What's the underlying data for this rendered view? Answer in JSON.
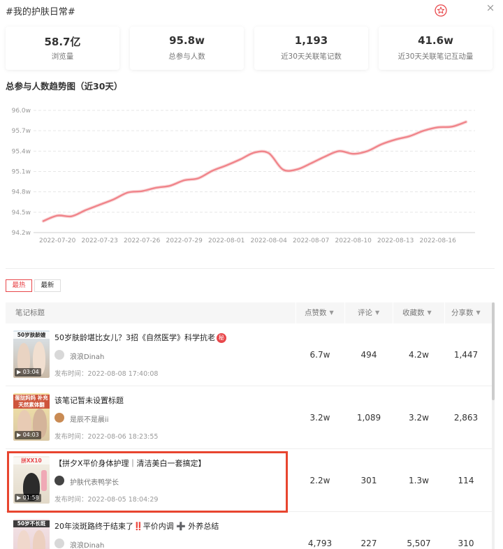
{
  "header": {
    "title": "#我的护肤日常#",
    "favorite_icon": "star-circle-icon",
    "close_icon": "close-icon",
    "close_glyph": "×"
  },
  "stats": [
    {
      "value": "58.7亿",
      "label": "浏览量"
    },
    {
      "value": "95.8w",
      "label": "总参与人数"
    },
    {
      "value": "1,193",
      "label": "近30天关联笔记数"
    },
    {
      "value": "41.6w",
      "label": "近30天关联笔记互动量"
    }
  ],
  "trend": {
    "title": "总参与人数趋势图（近30天）"
  },
  "chart_data": {
    "type": "line",
    "title": "",
    "xlabel": "",
    "ylabel": "",
    "ylim": [
      94.2,
      96.0
    ],
    "y_ticks": [
      "94.2w",
      "94.5w",
      "94.8w",
      "95.1w",
      "95.4w",
      "95.7w",
      "96.0w"
    ],
    "y_tick_values": [
      94.2,
      94.5,
      94.8,
      95.1,
      95.4,
      95.7,
      96.0
    ],
    "x_ticks": [
      "2022-07-20",
      "2022-07-23",
      "2022-07-26",
      "2022-07-29",
      "2022-08-01",
      "2022-08-04",
      "2022-08-07",
      "2022-08-10",
      "2022-08-13",
      "2022-08-16"
    ],
    "x": [
      "2022-07-19",
      "2022-07-20",
      "2022-07-21",
      "2022-07-22",
      "2022-07-23",
      "2022-07-24",
      "2022-07-25",
      "2022-07-26",
      "2022-07-27",
      "2022-07-28",
      "2022-07-29",
      "2022-07-30",
      "2022-07-31",
      "2022-08-01",
      "2022-08-02",
      "2022-08-03",
      "2022-08-04",
      "2022-08-05",
      "2022-08-06",
      "2022-08-07",
      "2022-08-08",
      "2022-08-09",
      "2022-08-10",
      "2022-08-11",
      "2022-08-12",
      "2022-08-13",
      "2022-08-14",
      "2022-08-15",
      "2022-08-16",
      "2022-08-17",
      "2022-08-18"
    ],
    "series": [
      {
        "values": [
          94.37,
          94.45,
          94.44,
          94.53,
          94.61,
          94.69,
          94.79,
          94.81,
          94.86,
          94.89,
          94.97,
          95.0,
          95.11,
          95.19,
          95.28,
          95.38,
          95.37,
          95.13,
          95.13,
          95.22,
          95.32,
          95.4,
          95.36,
          95.4,
          95.5,
          95.57,
          95.62,
          95.7,
          95.75,
          95.76,
          95.83
        ],
        "color": "#f0848a"
      }
    ],
    "grid": "horizontal dashed",
    "legend": "none"
  },
  "tabs": [
    {
      "label": "最热",
      "active": true
    },
    {
      "label": "最新",
      "active": false
    }
  ],
  "table": {
    "headers": {
      "title": "笔记标题",
      "likes": "点赞数",
      "comments": "评论",
      "collects": "收藏数",
      "shares": "分享数"
    },
    "sort_caret": "▼",
    "pub_prefix": "发布时间：",
    "rows": [
      {
        "thumb_caption": "50岁肤龄媲",
        "duration": "03:04",
        "title": "50岁肤龄堪比女儿？3招《自然医学》科学抗老",
        "badge": "秘",
        "author": "浪浪Dinah",
        "pub_time": "2022-08-08 17:40:08",
        "likes": "6.7w",
        "comments": "494",
        "collects": "4.2w",
        "shares": "1,447"
      },
      {
        "thumb_caption": "蛋挞妈妈 补充天然素体翻",
        "duration": "04:03",
        "title": "该笔记暂未设置标题",
        "author": "是辰不是晨ii",
        "pub_time": "2022-08-06 18:23:55",
        "likes": "3.2w",
        "comments": "1,089",
        "collects": "3.2w",
        "shares": "2,863"
      },
      {
        "thumb_caption": "拼XX10",
        "duration": "01:58",
        "title": "【拼夕X平价身体护理｜清洁美白一套搞定】",
        "author": "护肤代表鸭学长",
        "pub_time": "2022-08-05 18:04:29",
        "likes": "2.2w",
        "comments": "301",
        "collects": "1.3w",
        "shares": "114"
      },
      {
        "thumb_caption": "50岁不长斑",
        "duration": "",
        "title": "20年淡斑路终于结束了‼️平价内调 ➕ 外养总结",
        "author": "浪浪Dinah",
        "pub_time": "",
        "likes": "4,793",
        "comments": "227",
        "collects": "5,507",
        "shares": "310"
      }
    ]
  },
  "colors": {
    "accent": "#e8474b",
    "line": "#f0848a",
    "highlight_box": "#e8452f"
  }
}
